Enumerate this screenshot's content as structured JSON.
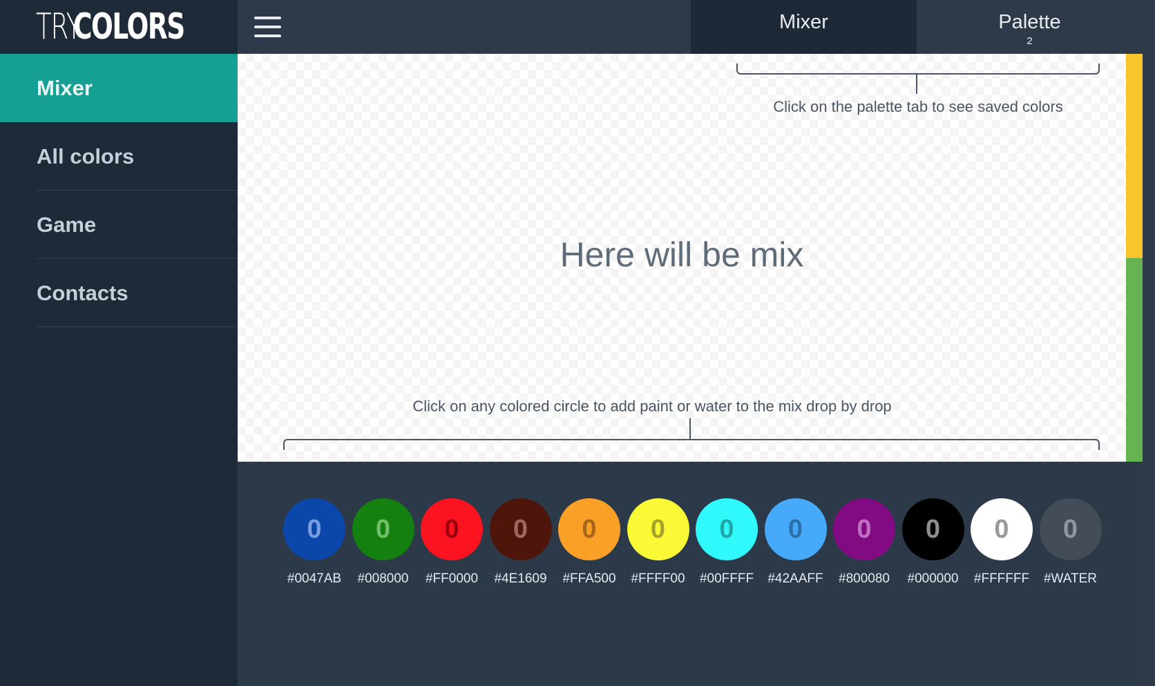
{
  "app": {
    "logo_thin": "TRY",
    "logo_bold": "COLORS"
  },
  "sidebar": {
    "items": [
      {
        "label": "Mixer",
        "active": true
      },
      {
        "label": "All colors",
        "active": false
      },
      {
        "label": "Game",
        "active": false
      },
      {
        "label": "Contacts",
        "active": false
      }
    ]
  },
  "header": {
    "menu_icon": "hamburger-icon",
    "tabs": [
      {
        "label": "Mixer",
        "count": ""
      },
      {
        "label": "Palette",
        "count": "2"
      }
    ]
  },
  "mixer": {
    "hint_top": "Click on the palette tab to see saved colors",
    "placeholder": "Here will be mix",
    "hint_bottom": "Click on any colored circle to add paint or water to the mix drop by drop",
    "side_colors": [
      "#F8C52C",
      "#66B451"
    ]
  },
  "paints": [
    {
      "code": "#0047AB",
      "count": "0",
      "color": "#0B47AB",
      "text_color": "#7A9CE0"
    },
    {
      "code": "#008000",
      "count": "0",
      "color": "#13800F",
      "text_color": "#6FC066"
    },
    {
      "code": "#FF0000",
      "count": "0",
      "color": "#FB1320",
      "text_color": "#9A0010"
    },
    {
      "code": "#4E1609",
      "count": "0",
      "color": "#4E160B",
      "text_color": "#9A6A60"
    },
    {
      "code": "#FFA500",
      "count": "0",
      "color": "#FAA027",
      "text_color": "#A8661A"
    },
    {
      "code": "#FFFF00",
      "count": "0",
      "color": "#FAF936",
      "text_color": "#A6A32A"
    },
    {
      "code": "#00FFFF",
      "count": "0",
      "color": "#2FF9FA",
      "text_color": "#22A6A8"
    },
    {
      "code": "#42AAFF",
      "count": "0",
      "color": "#47A9FA",
      "text_color": "#2E70A8"
    },
    {
      "code": "#800080",
      "count": "0",
      "color": "#820B84",
      "text_color": "#C070C2"
    },
    {
      "code": "#000000",
      "count": "0",
      "color": "#000000",
      "text_color": "#8E8E8E"
    },
    {
      "code": "#FFFFFF",
      "count": "0",
      "color": "#FFFFFF",
      "text_color": "#9A9A9A"
    },
    {
      "code": "#WATER",
      "count": "0",
      "color": "#434C57",
      "text_color": "#8E96A0"
    }
  ]
}
